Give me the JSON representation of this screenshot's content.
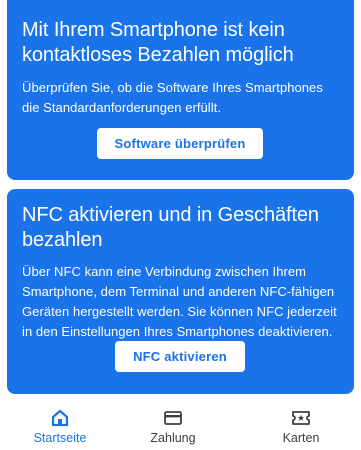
{
  "cards": [
    {
      "title": "Mit Ihrem Smartphone ist kein kontaktloses Bezahlen möglich",
      "body": "Überprüfen Sie, ob die Software Ihres Smartphones die Standardanforderungen erfüllt.",
      "button": "Software überprüfen"
    },
    {
      "title": "NFC aktivieren und in Geschäften bezahlen",
      "body": "Über NFC kann eine Verbindung zwischen Ihrem Smartphone, dem Terminal und anderen NFC-fähigen Geräten hergestellt werden. Sie können NFC jederzeit in den Einstellungen Ihres Smartphones deaktivieren.",
      "button": "NFC aktivieren"
    }
  ],
  "bottom_nav": {
    "items": [
      {
        "label": "Startseite",
        "icon": "home-icon",
        "active": true
      },
      {
        "label": "Zahlung",
        "icon": "credit-card-icon",
        "active": false
      },
      {
        "label": "Karten",
        "icon": "ticket-icon",
        "active": false
      }
    ]
  },
  "colors": {
    "accent": "#1a73e8",
    "card_text": "#ffffff",
    "nav_inactive": "#3c4043"
  }
}
